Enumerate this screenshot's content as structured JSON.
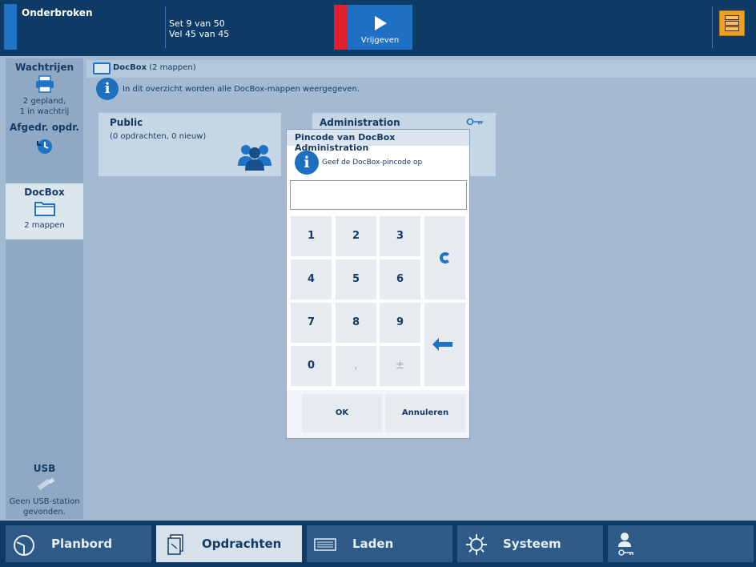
{
  "topbar": {
    "status": "Onderbroken",
    "set_info": "Set 9 van 50",
    "sheet_info": "Vel 45 van 45",
    "release_label": "Vrijgeven"
  },
  "sidebar": {
    "queues": {
      "title": "Wachtrijen",
      "line1": "2 gepland,",
      "line2": "1 in wachtrij"
    },
    "printed": {
      "title": "Afgedr. opdr."
    },
    "docbox": {
      "title": "DocBox",
      "sub": "2 mappen"
    },
    "usb": {
      "title": "USB",
      "line1": "Geen USB-station",
      "line2": "gevonden."
    }
  },
  "crumb": {
    "name": "DocBox",
    "count": "(2 mappen)"
  },
  "info_text": "In dit overzicht worden alle DocBox-mappen weergegeven.",
  "tiles": [
    {
      "title": "Public",
      "sub": "(0 opdrachten, 0 nieuw)"
    },
    {
      "title": "Administration"
    }
  ],
  "dialog": {
    "title": "Pincode van DocBox Administration",
    "info": "Geef de DocBox-pincode op",
    "pin_value": "",
    "keys": {
      "k1": "1",
      "k2": "2",
      "k3": "3",
      "k4": "4",
      "k5": "5",
      "k6": "6",
      "k7": "7",
      "k8": "8",
      "k9": "9",
      "k0": "0",
      "comma": ",",
      "plusminus": "±"
    },
    "ok_label": "OK",
    "cancel_label": "Annuleren"
  },
  "bottom_nav": [
    {
      "label": "Planbord"
    },
    {
      "label": "Opdrachten"
    },
    {
      "label": "Laden"
    },
    {
      "label": "Systeem"
    }
  ],
  "colors": {
    "dark_blue": "#0e3a66",
    "accent_blue": "#1e73c7",
    "alert_red": "#e0202f",
    "server_orange": "#f0a020"
  }
}
